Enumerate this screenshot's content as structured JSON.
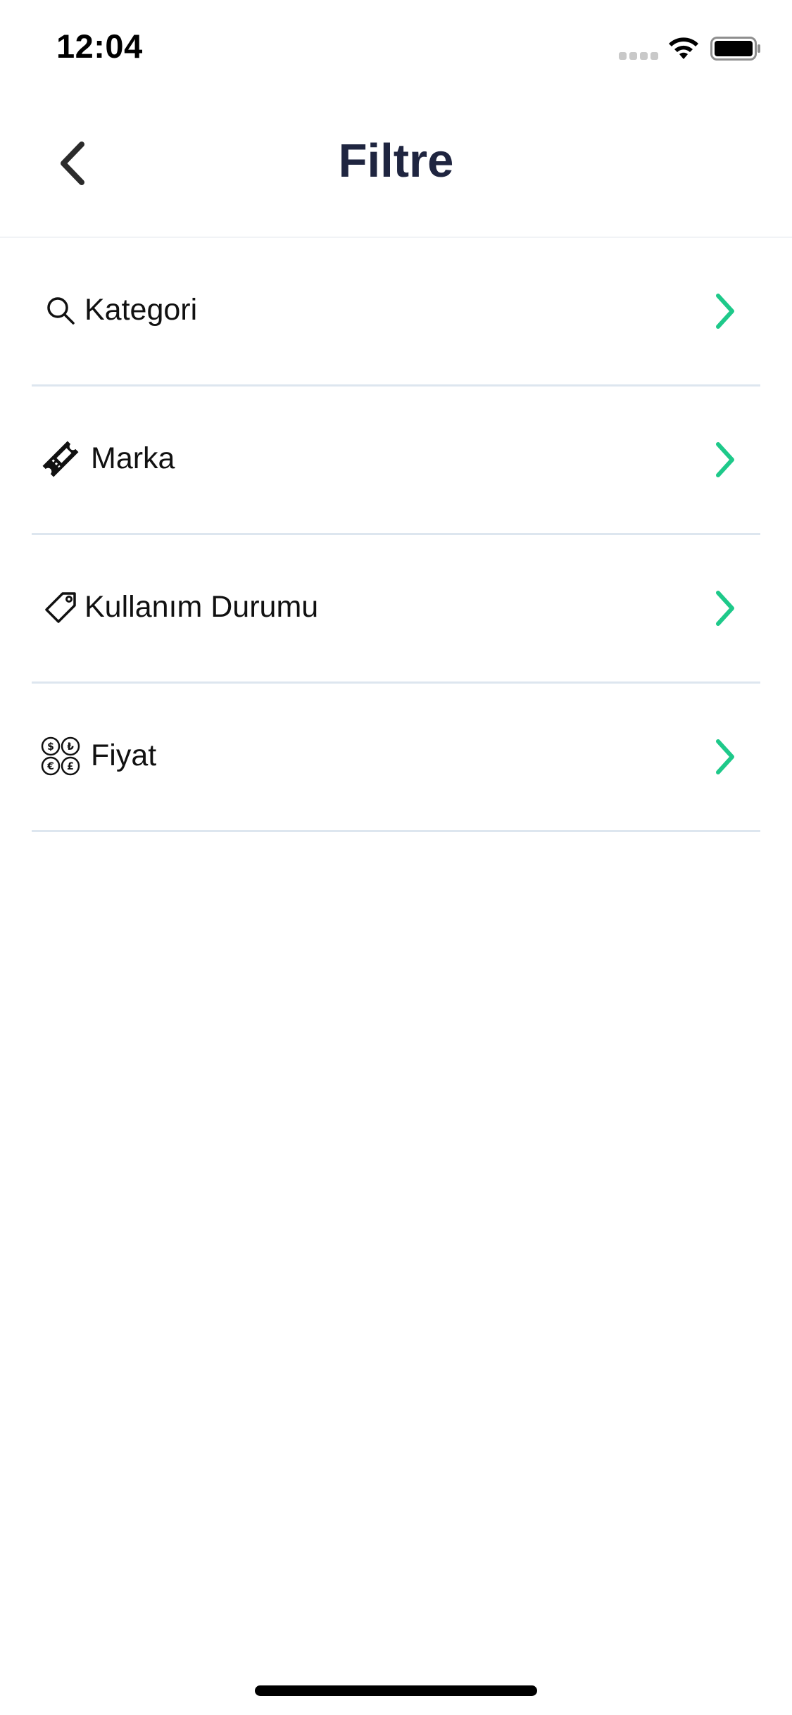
{
  "status_bar": {
    "time": "12:04"
  },
  "nav": {
    "title": "Filtre",
    "back_icon": "chevron-left-icon"
  },
  "filters": [
    {
      "label": "Kategori",
      "icon": "search-icon"
    },
    {
      "label": "Marka",
      "icon": "ticket-icon"
    },
    {
      "label": "Kullanım Durumu",
      "icon": "tag-icon"
    },
    {
      "label": "Fiyat",
      "icon": "currency-coins-icon"
    }
  ],
  "colors": {
    "title": "#1f2540",
    "accent": "#1ec98a",
    "divider": "#dde6ef",
    "text": "#111111"
  }
}
